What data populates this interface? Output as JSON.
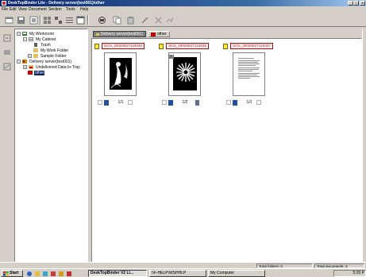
{
  "window": {
    "title": "DeskTopBinder Lite - Delivery server(test001)/other"
  },
  "menu": [
    "File",
    "Edit",
    "View",
    "Document",
    "Section",
    "Tools",
    "Help"
  ],
  "toolbar": [
    "new-document-icon",
    "save-icon",
    "print-icon",
    "properties-icon",
    "large-icons-view-icon",
    "list-view-icon",
    "details-view-icon",
    "scan-icon",
    "copy-icon",
    "paste-icon",
    "cut-icon",
    "tools-icon",
    "transfer-icon"
  ],
  "tree": {
    "root": "My Workroom",
    "cabinet": "My Cabinet",
    "trash": "Trash",
    "work_folder": "My Work Folder",
    "sample_folder": "Sample Folder",
    "delivery_server": "Delivery server(test001)",
    "undelivered": "Undelivered Data In-Tray",
    "other": "other"
  },
  "tabs": [
    "Delivery server(test001)",
    "other"
  ],
  "documents": [
    {
      "name": "SCN_20020527124046",
      "page": "1/1"
    },
    {
      "name": "SCN_20020527124035",
      "page": "1/2"
    },
    {
      "name": "SCN_20020527123437",
      "page": "1/1"
    }
  ],
  "status": {
    "total_folders": "Total folders: 0",
    "total_documents": "Total documents: 3"
  },
  "taskbar": {
    "start": "Start",
    "tasks": [
      "DeskTopBinder V2 Li...",
      "\\\\F-HELP\\WSHHLP",
      "My Computer"
    ],
    "clock": "5:20 P"
  },
  "colors": {
    "title_start": "#0a246a",
    "accent_red": "#c00000",
    "selection": "#0a246a"
  }
}
